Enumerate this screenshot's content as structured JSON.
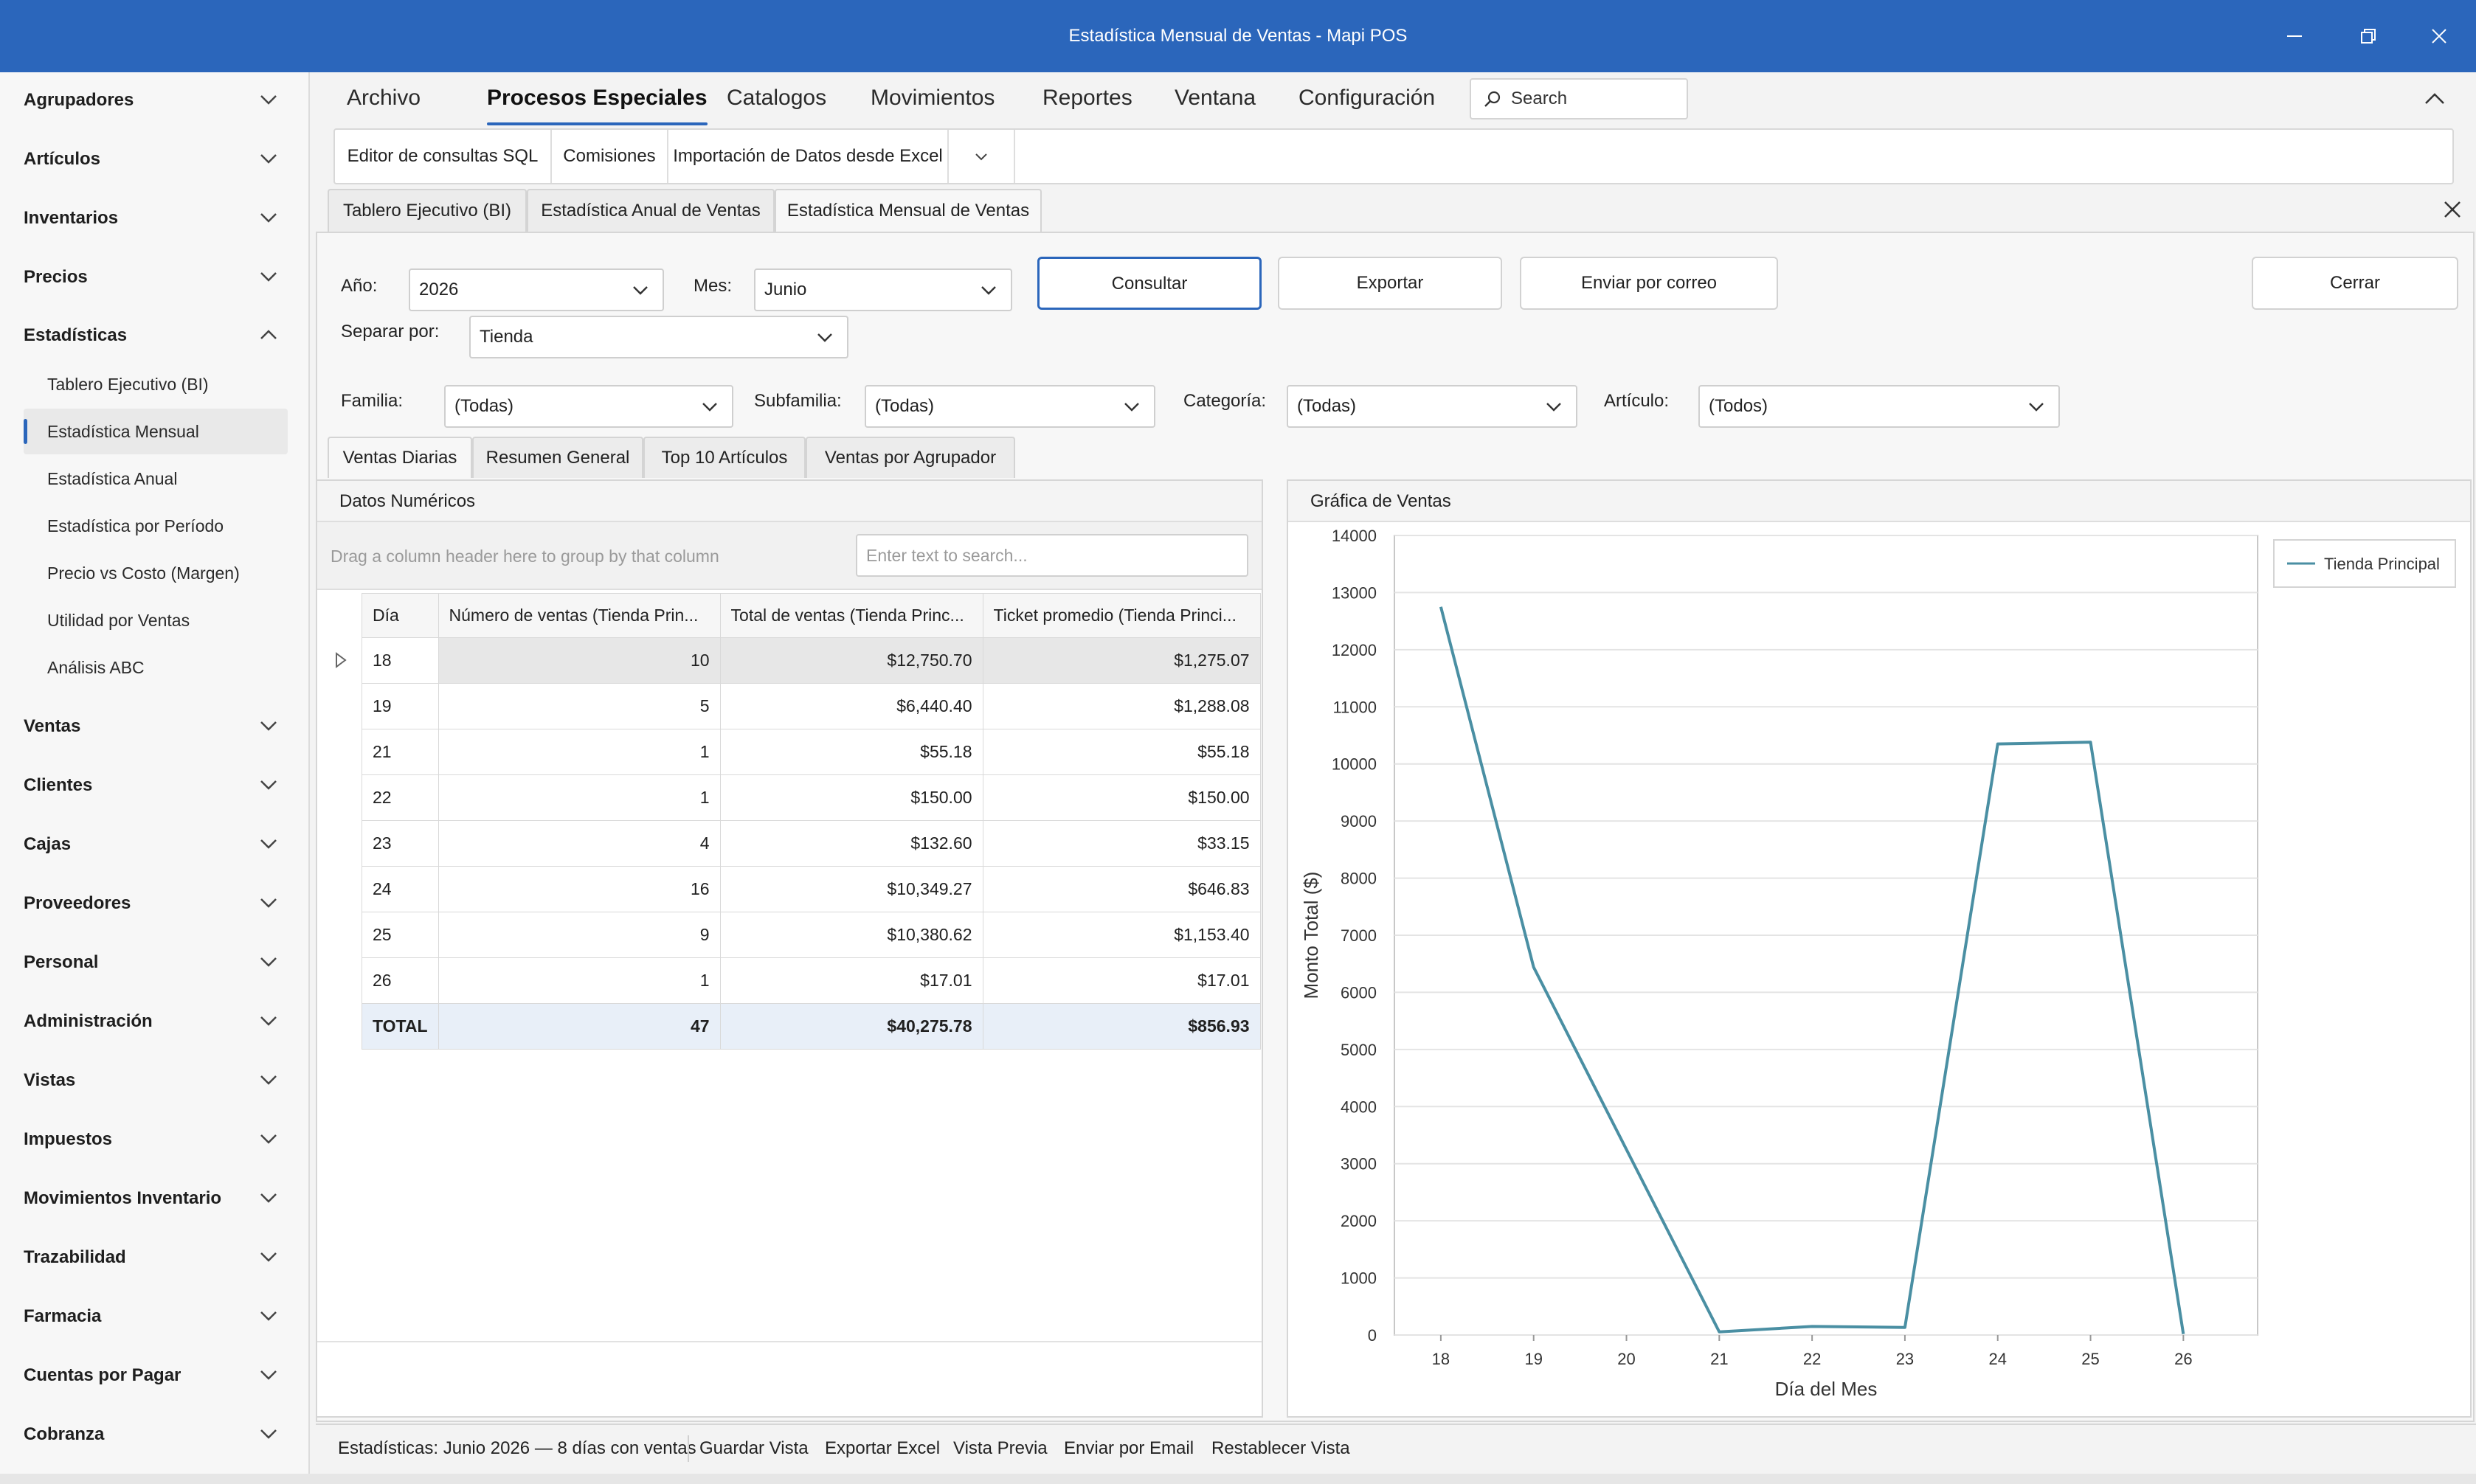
{
  "window": {
    "title": "Estadística Mensual de Ventas - Mapi POS"
  },
  "sidebar": {
    "groups_top": [
      "Agrupadores",
      "Artículos",
      "Inventarios",
      "Precios",
      "Estadísticas"
    ],
    "estadisticas_items": [
      "Tablero Ejecutivo (BI)",
      "Estadística Mensual",
      "Estadística Anual",
      "Estadística por Período",
      "Precio vs Costo (Margen)",
      "Utilidad por Ventas",
      "Análisis ABC"
    ],
    "groups_bottom": [
      "Ventas",
      "Clientes",
      "Cajas",
      "Proveedores",
      "Personal",
      "Administración",
      "Vistas",
      "Impuestos",
      "Movimientos Inventario",
      "Trazabilidad",
      "Farmacia",
      "Cuentas por Pagar",
      "Cobranza"
    ]
  },
  "menu": [
    "Archivo",
    "Procesos Especiales",
    "Catalogos",
    "Movimientos",
    "Reportes",
    "Ventana",
    "Configuración"
  ],
  "search": {
    "placeholder": "Search"
  },
  "ribbon": [
    "Editor de consultas SQL",
    "Comisiones",
    "Importación de Datos desde Excel"
  ],
  "doc_tabs": [
    "Tablero Ejecutivo (BI)",
    "Estadística Anual de Ventas",
    "Estadística Mensual de Ventas"
  ],
  "filters": {
    "anio_label": "Año:",
    "anio": "2026",
    "mes_label": "Mes:",
    "mes": "Junio",
    "separar_label": "Separar por:",
    "separar": "Tienda",
    "familia_label": "Familia:",
    "familia": "(Todas)",
    "subfamilia_label": "Subfamilia:",
    "subfamilia": "(Todas)",
    "categoria_label": "Categoría:",
    "categoria": "(Todas)",
    "articulo_label": "Artículo:",
    "articulo": "(Todos)"
  },
  "buttons": {
    "consultar": "Consultar",
    "exportar": "Exportar",
    "enviar": "Enviar por correo",
    "cerrar": "Cerrar"
  },
  "inner_tabs": [
    "Ventas Diarias",
    "Resumen General",
    "Top 10 Artículos",
    "Ventas por Agrupador"
  ],
  "grid": {
    "panel_title": "Datos Numéricos",
    "group_hint": "Drag a column header here to group by that column",
    "search_placeholder": "Enter text to search...",
    "columns": [
      "Día",
      "Número de ventas (Tienda Prin...",
      "Total de ventas (Tienda Princ...",
      "Ticket promedio (Tienda Princi..."
    ],
    "rows": [
      [
        "18",
        "10",
        "$12,750.70",
        "$1,275.07"
      ],
      [
        "19",
        "5",
        "$6,440.40",
        "$1,288.08"
      ],
      [
        "21",
        "1",
        "$55.18",
        "$55.18"
      ],
      [
        "22",
        "1",
        "$150.00",
        "$150.00"
      ],
      [
        "23",
        "4",
        "$132.60",
        "$33.15"
      ],
      [
        "24",
        "16",
        "$10,349.27",
        "$646.83"
      ],
      [
        "25",
        "9",
        "$10,380.62",
        "$1,153.40"
      ],
      [
        "26",
        "1",
        "$17.01",
        "$17.01"
      ]
    ],
    "total": [
      "TOTAL",
      "47",
      "$40,275.78",
      "$856.93"
    ]
  },
  "chart_panel_title": "Gráfica de Ventas",
  "chart_data": {
    "type": "line",
    "categories": [
      "18",
      "19",
      "20",
      "21",
      "22",
      "23",
      "24",
      "25",
      "26"
    ],
    "x": [
      18,
      19,
      21,
      22,
      23,
      24,
      25,
      26
    ],
    "series": [
      {
        "name": "Tienda Principal",
        "values": [
          12750.7,
          6440.4,
          55.18,
          150.0,
          132.6,
          10349.27,
          10380.62,
          17.01
        ],
        "color": "#4a8fa3"
      }
    ],
    "xlabel": "Día del Mes",
    "ylabel": "Monto Total ($)",
    "ylim": [
      0,
      14000
    ],
    "yticks": [
      0,
      1000,
      2000,
      3000,
      4000,
      5000,
      6000,
      7000,
      8000,
      9000,
      10000,
      11000,
      12000,
      13000,
      14000
    ],
    "grid": true,
    "legend": "top-right"
  },
  "statusbar": [
    "Estadísticas: Junio 2026 — 8 días con ventas",
    "Guardar Vista",
    "Exportar Excel",
    "Vista Previa",
    "Enviar por Email",
    "Restablecer Vista"
  ],
  "colors": {
    "accent": "#2b66bb",
    "series": "#4a8fa3"
  }
}
